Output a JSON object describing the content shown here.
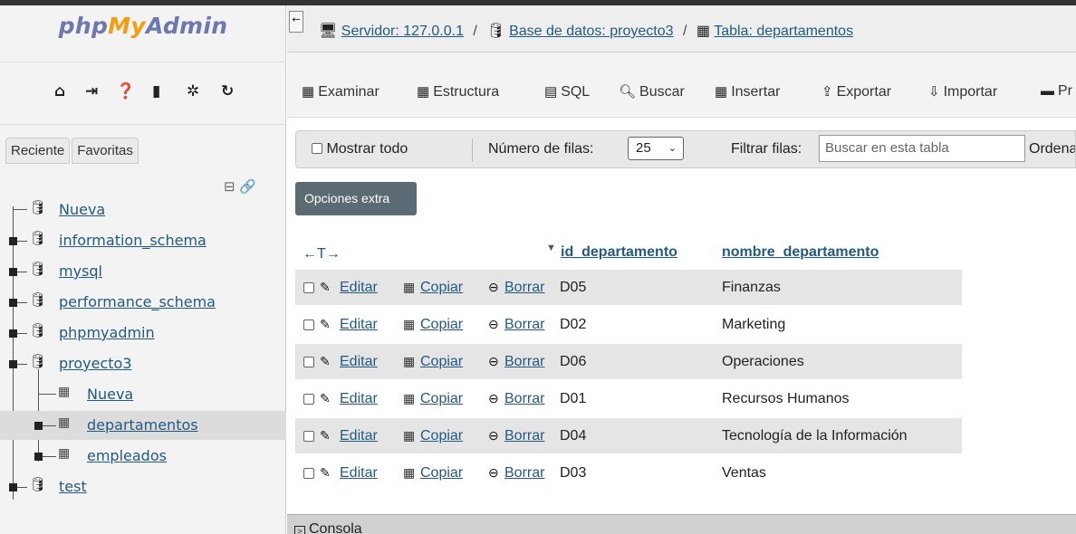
{
  "logo": {
    "part1": "php",
    "part2": "My",
    "part3": "Admin"
  },
  "nav_icons": [
    "home-icon",
    "logout-icon",
    "help-icon",
    "docs-icon",
    "settings-icon",
    "reload-icon"
  ],
  "left_tabs": {
    "recent": "Reciente",
    "favorites": "Favoritas"
  },
  "tree": {
    "new": "Nueva",
    "dbs": [
      "information_schema",
      "mysql",
      "performance_schema",
      "phpmyadmin",
      "proyecto3"
    ],
    "proyecto3_new": "Nueva",
    "tables": [
      "departamentos",
      "empleados"
    ],
    "last_db": "test"
  },
  "breadcrumb": {
    "server": "Servidor: 127.0.0.1",
    "database": "Base de datos: proyecto3",
    "table": "Tabla: departamentos",
    "separator": "/"
  },
  "menu": {
    "browse": "Examinar",
    "structure": "Estructura",
    "sql": "SQL",
    "search": "Buscar",
    "insert": "Insertar",
    "export": "Exportar",
    "import": "Importar",
    "more": "Pr"
  },
  "navbar": {
    "show_all": "Mostrar todo",
    "rows_label": "Número de filas:",
    "rows_value": "25",
    "filter_label": "Filtrar filas:",
    "filter_placeholder": "Buscar en esta tabla",
    "order_label": "Ordena"
  },
  "options_button": "Opciones extra",
  "table": {
    "arrows": "←T→",
    "col_id": "id_departamento",
    "col_name": "nombre_departamento",
    "actions": {
      "edit": "Editar",
      "copy": "Copiar",
      "delete": "Borrar"
    },
    "rows": [
      {
        "id": "D05",
        "name": "Finanzas"
      },
      {
        "id": "D02",
        "name": "Marketing"
      },
      {
        "id": "D06",
        "name": "Operaciones"
      },
      {
        "id": "D01",
        "name": "Recursos Humanos"
      },
      {
        "id": "D04",
        "name": "Tecnología de la Información"
      },
      {
        "id": "D03",
        "name": "Ventas"
      }
    ]
  },
  "console": "Consola",
  "colors": {
    "link": "#235a81",
    "logo_blue": "#6c78af",
    "logo_orange": "#f89c0e",
    "button": "#5b6a73"
  }
}
